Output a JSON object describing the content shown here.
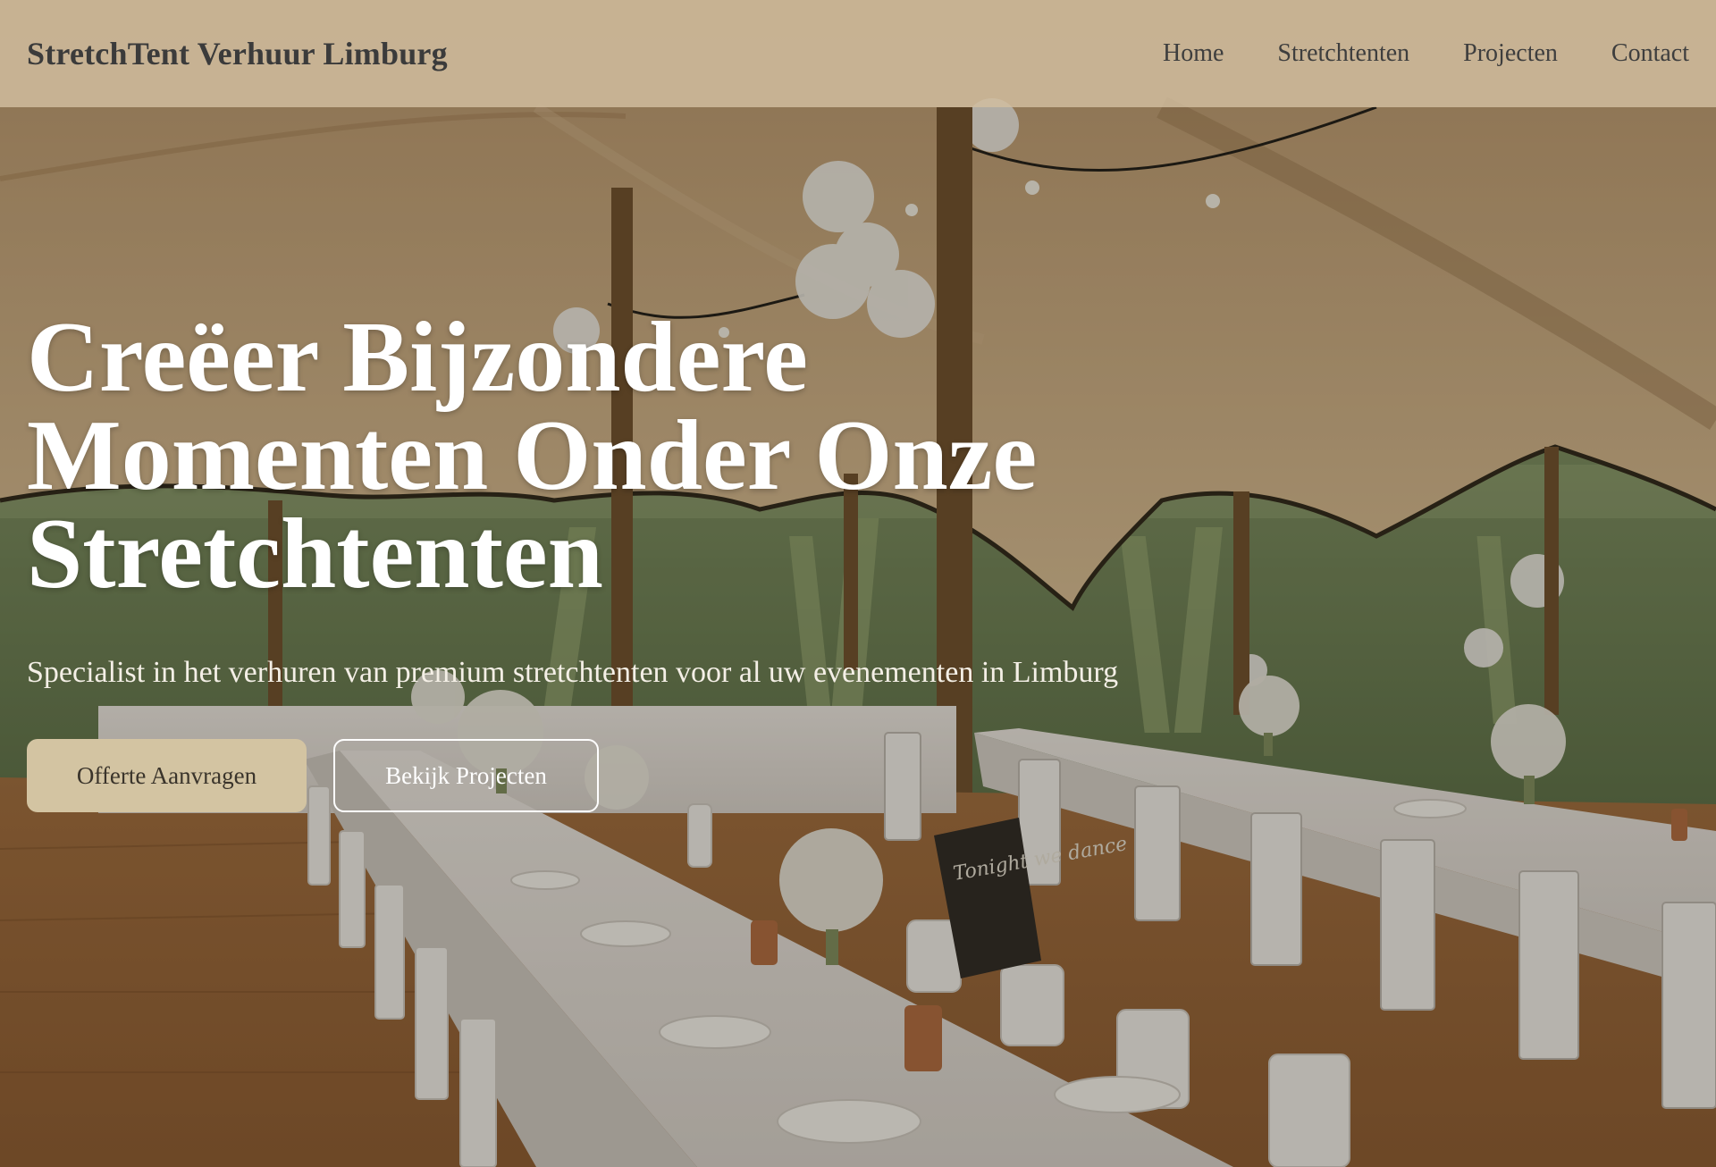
{
  "header": {
    "brand": "StretchTent Verhuur Limburg",
    "nav": [
      {
        "label": "Home"
      },
      {
        "label": "Stretchtenten"
      },
      {
        "label": "Projecten"
      },
      {
        "label": "Contact"
      }
    ]
  },
  "hero": {
    "title_lines": [
      "Creëer Bijzondere",
      "Momenten Onder Onze",
      "Stretchtenten"
    ],
    "subtitle": "Specialist in het verhuren van premium stretchtenten voor al uw evenementen in Limburg",
    "primary_cta": "Offerte Aanvragen",
    "secondary_cta": "Bekijk Projecten",
    "image_subject": "wedding-table-setup-under-stretch-tent",
    "chalkboard_text": "Tonight we dance"
  },
  "colors": {
    "header_bg": "#d2bea0",
    "accent": "#d3c4a2",
    "text_dark": "#3b3b3b",
    "text_light": "#ffffff",
    "tent_canvas": "#c9a77c",
    "floor_wood": "#9a6a3e"
  }
}
